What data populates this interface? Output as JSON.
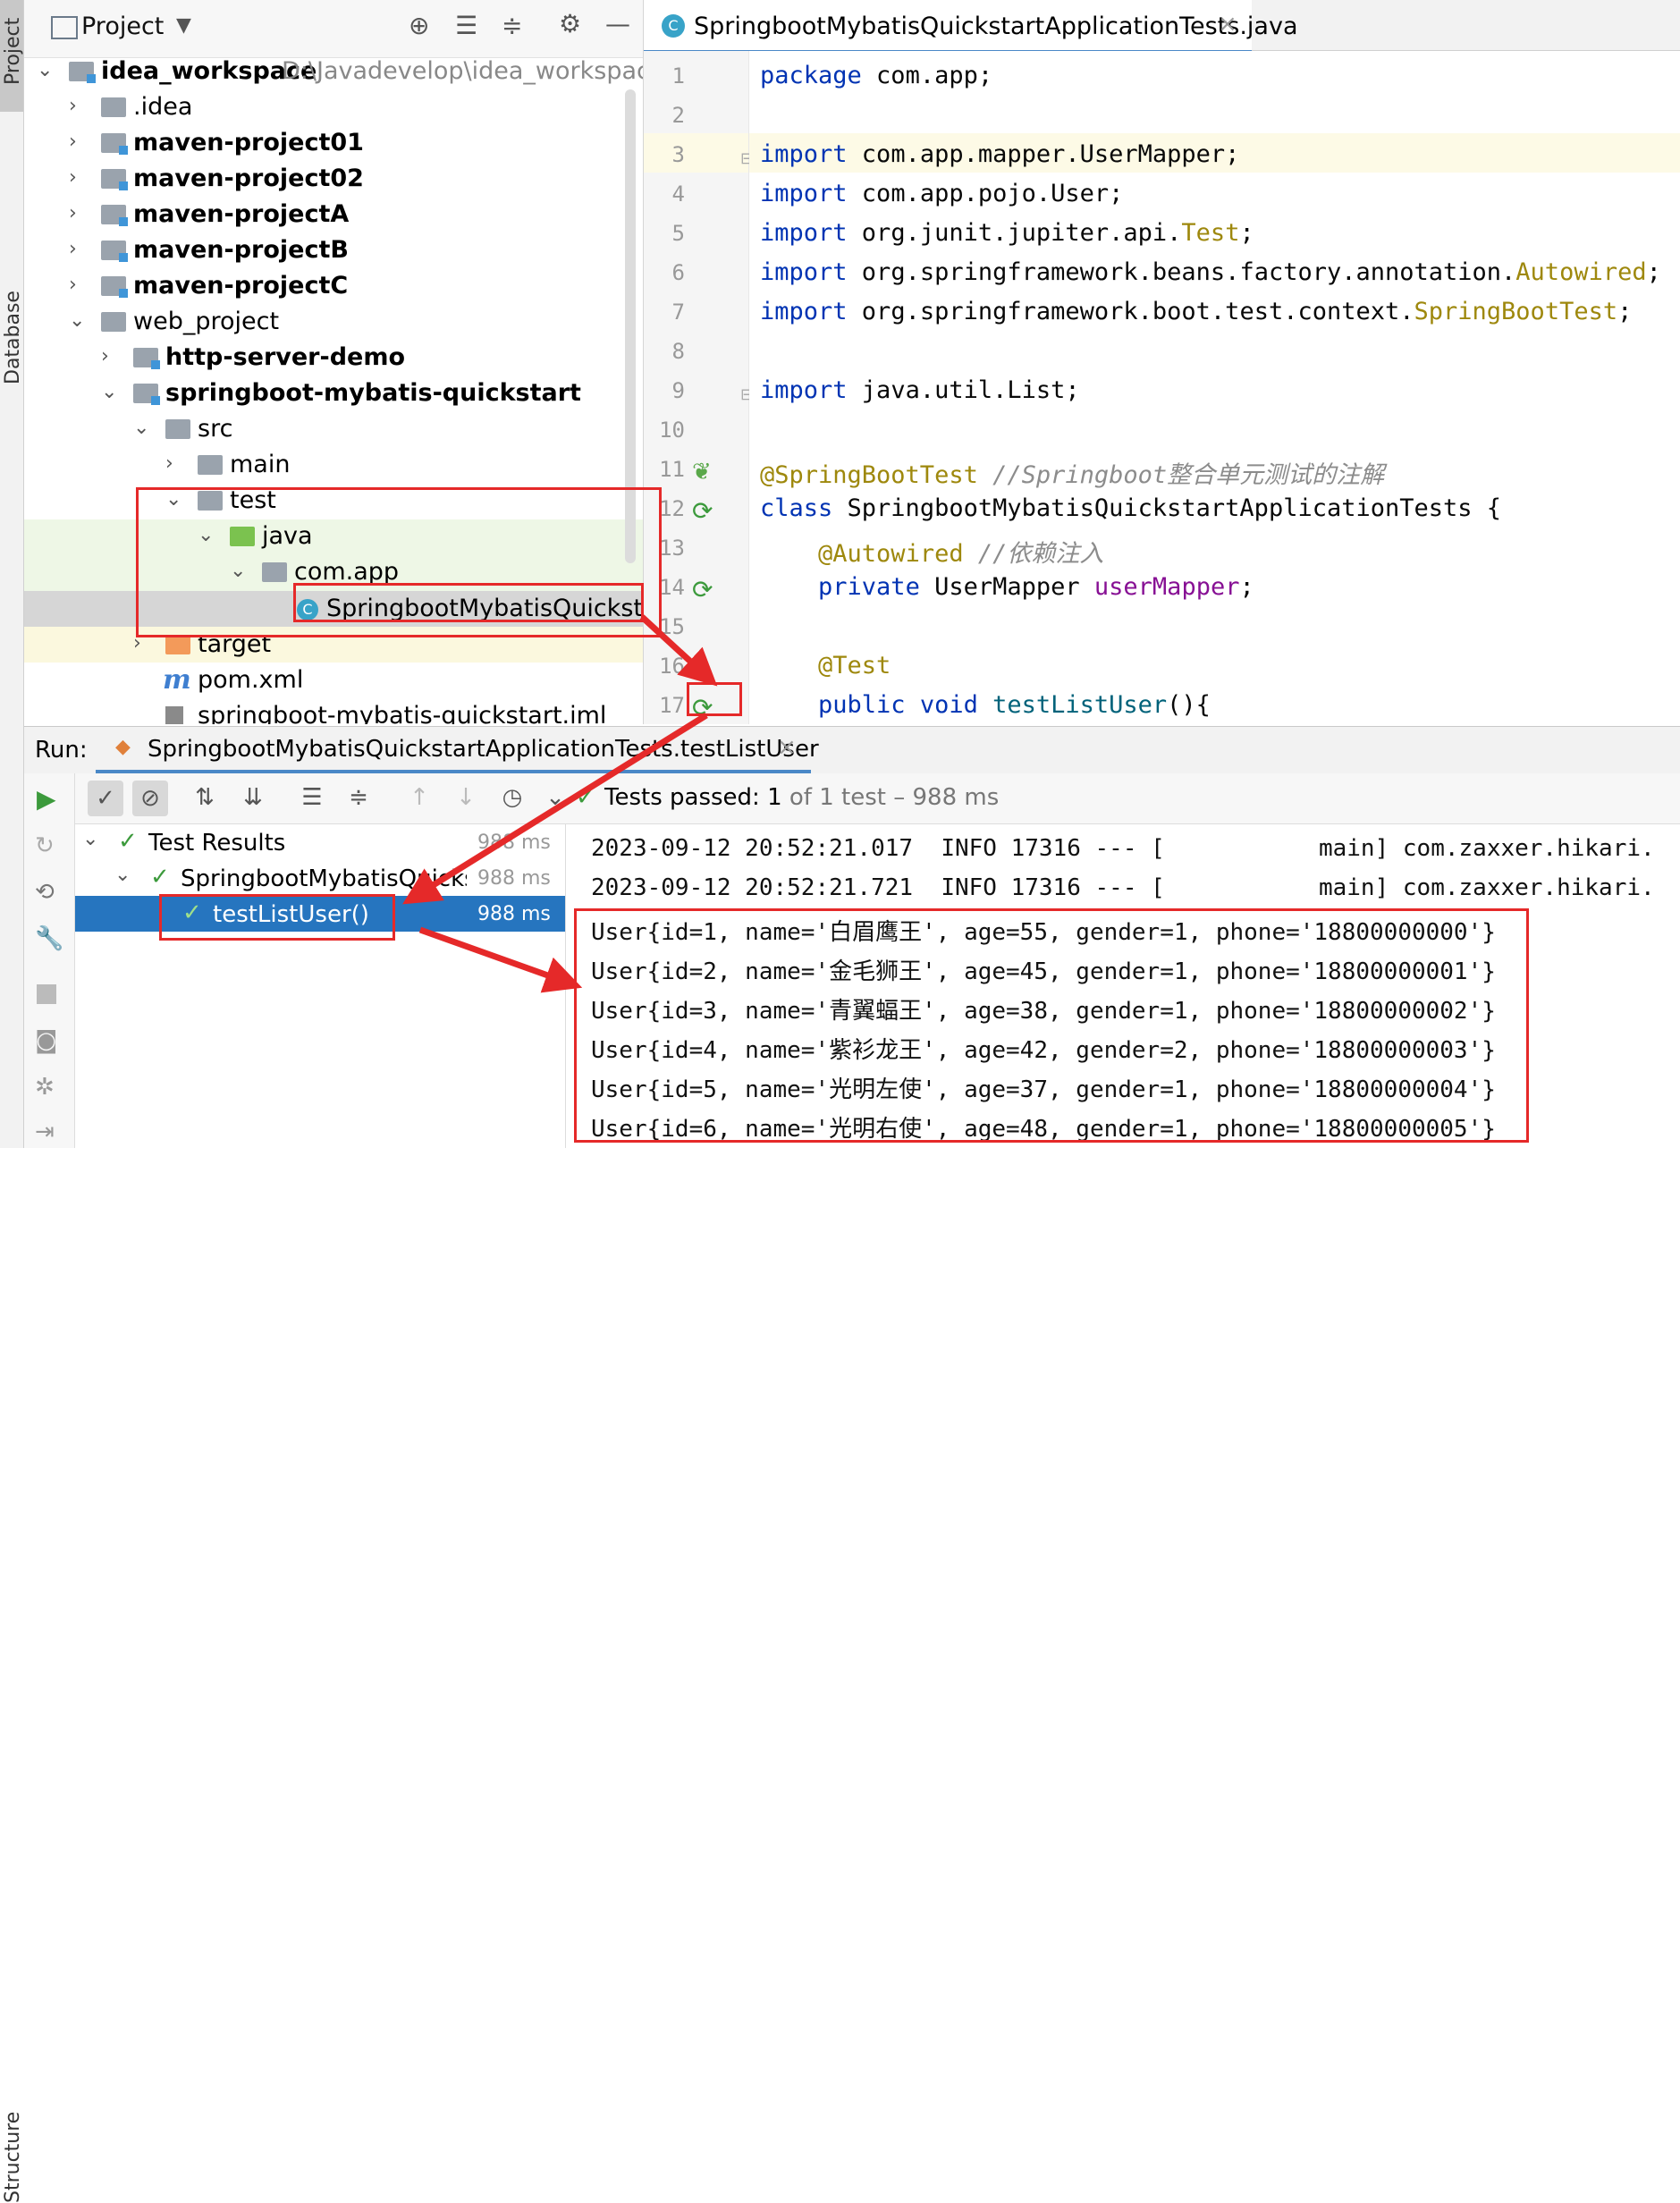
{
  "sidebar_tabs": {
    "project": "Project",
    "database": "Database",
    "structure": "Structure"
  },
  "project_panel": {
    "title": "Project",
    "tree": [
      {
        "label": "idea_workspace",
        "path": "D:\\Javadevelop\\idea_workspace",
        "expanded": true
      },
      {
        "label": ".idea"
      },
      {
        "label": "maven-project01"
      },
      {
        "label": "maven-project02"
      },
      {
        "label": "maven-projectA"
      },
      {
        "label": "maven-projectB"
      },
      {
        "label": "maven-projectC"
      },
      {
        "label": "web_project"
      },
      {
        "label": "http-server-demo"
      },
      {
        "label": "springboot-mybatis-quickstart"
      },
      {
        "label": "src"
      },
      {
        "label": "main"
      },
      {
        "label": "test"
      },
      {
        "label": "java"
      },
      {
        "label": "com.app"
      },
      {
        "label": "SpringbootMybatisQuickstartA"
      },
      {
        "label": "target"
      },
      {
        "label": "pom.xml"
      },
      {
        "label": "springboot-mybatis-quickstart.iml"
      }
    ]
  },
  "editor": {
    "tab_label": "SpringbootMybatisQuickstartApplicationTests.java",
    "line_numbers": [
      "1",
      "2",
      "3",
      "4",
      "5",
      "6",
      "7",
      "8",
      "9",
      "10",
      "11",
      "12",
      "13",
      "14",
      "15",
      "16",
      "17"
    ],
    "code": {
      "l1_kw": "package",
      "l1_rest": " com.app;",
      "l3_kw": "import",
      "l3_rest": " com.app.mapper.UserMapper;",
      "l4_kw": "import",
      "l4_rest": " com.app.pojo.User;",
      "l5_kw": "import",
      "l5_rest": " org.junit.jupiter.api.",
      "l5_cls": "Test",
      "l5_end": ";",
      "l6_kw": "import",
      "l6_rest": " org.springframework.beans.factory.annotation.",
      "l6_cls": "Autowired",
      "l6_end": ";",
      "l7_kw": "import",
      "l7_rest": " org.springframework.boot.test.context.",
      "l7_cls": "SpringBootTest",
      "l7_end": ";",
      "l9_kw": "import",
      "l9_rest": " java.util.List;",
      "l11_ann": "@SpringBootTest",
      "l11_cmt": " //Springboot整合单元测试的注解",
      "l12_kw": "class",
      "l12_rest": " SpringbootMybatisQuickstartApplicationTests {",
      "l13_ann": "@Autowired",
      "l13_cmt": " //依赖注入",
      "l14_kw": "private",
      "l14_rest": " UserMapper ",
      "l14_fld": "userMapper",
      "l14_end": ";",
      "l16_ann": "@Test",
      "l17_kw": "public void",
      "l17_mth": " testListUser",
      "l17_end": "(){"
    }
  },
  "run_panel": {
    "label": "Run:",
    "tab_label": "SpringbootMybatisQuickstartApplicationTests.testListUser",
    "status_prefix": "Tests passed:",
    "status_count": "1",
    "status_suffix": "of 1 test – 988 ms",
    "results": [
      {
        "label": "Test Results",
        "time": "988 ms"
      },
      {
        "label": "SpringbootMybatisQuickstart",
        "time": "988 ms"
      },
      {
        "label": "testListUser()",
        "time": "988 ms"
      }
    ],
    "console": [
      "2023-09-12 20:52:21.017  INFO 17316 --- [           main] com.zaxxer.hikari.",
      "2023-09-12 20:52:21.721  INFO 17316 --- [           main] com.zaxxer.hikari.",
      "User{id=1, name='白眉鹰王', age=55, gender=1, phone='18800000000'}",
      "User{id=2, name='金毛狮王', age=45, gender=1, phone='18800000001'}",
      "User{id=3, name='青翼蝠王', age=38, gender=1, phone='18800000002'}",
      "User{id=4, name='紫衫龙王', age=42, gender=2, phone='18800000003'}",
      "User{id=5, name='光明左使', age=37, gender=1, phone='18800000004'}",
      "User{id=6, name='光明右使', age=48, gender=1, phone='18800000005'}"
    ]
  },
  "colors": {
    "annotation_red": "#e52929",
    "selection_blue": "#2675bf",
    "pass_green": "#3c9a3c"
  }
}
